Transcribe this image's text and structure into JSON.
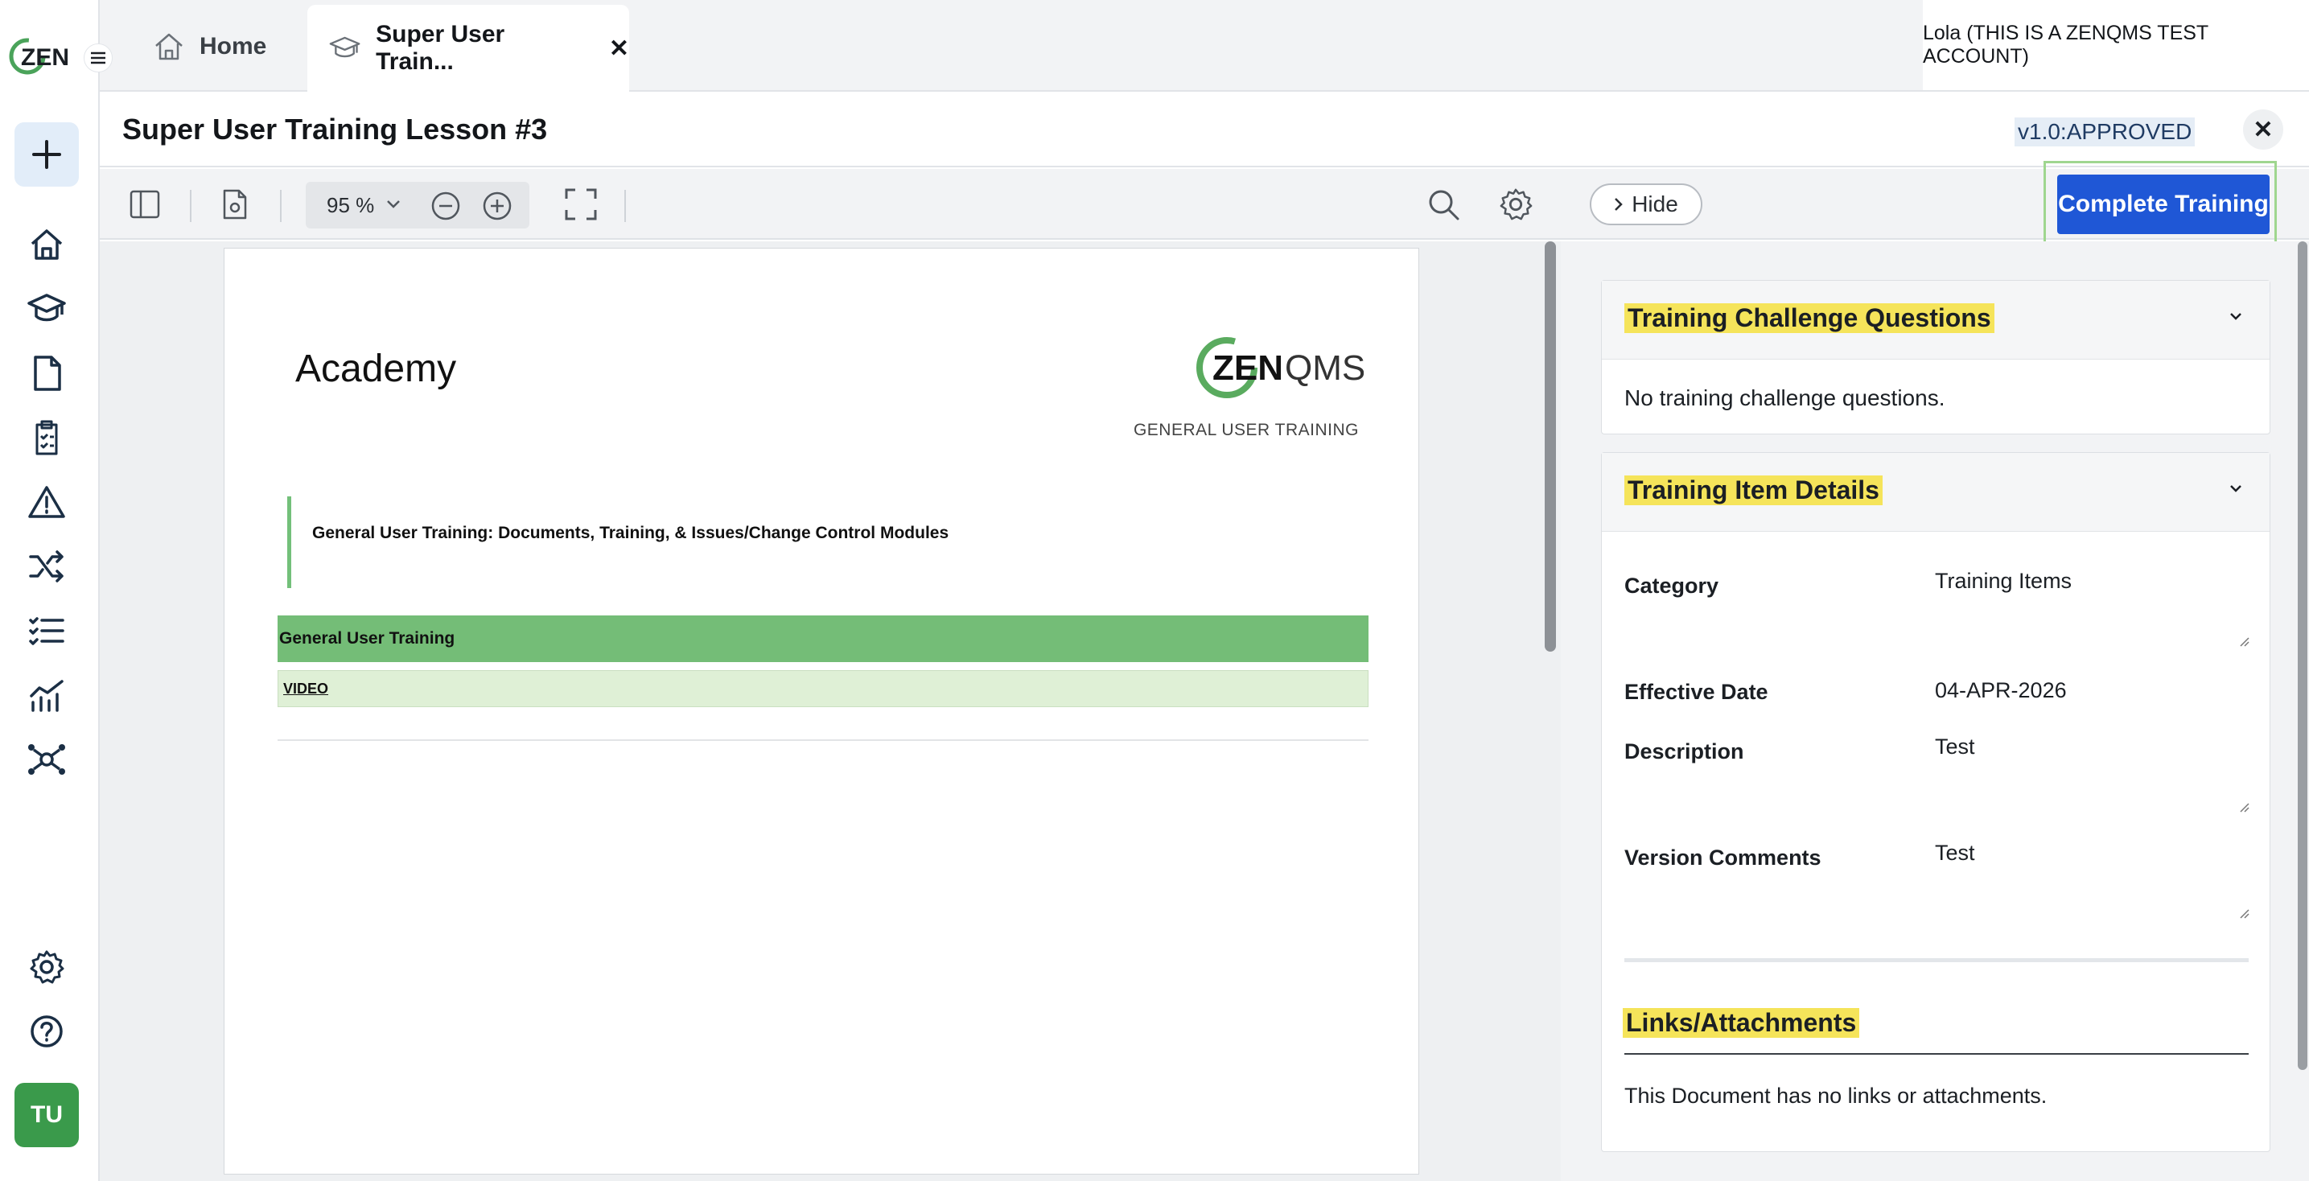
{
  "app": {
    "logo_text": "ZEN",
    "avatar_initials": "TU"
  },
  "tabs": {
    "home_label": "Home",
    "active_label": "Super User Train...",
    "close_symbol": "✕"
  },
  "user": {
    "name": "Lola (THIS IS A ZENQMS TEST ACCOUNT)"
  },
  "document": {
    "title": "Super User Training Lesson #3",
    "version_status": "v1.0:APPROVED",
    "close_symbol": "✕"
  },
  "toolbar": {
    "zoom_value": "95 %",
    "hide_label": "Hide",
    "complete_label": "Complete Training"
  },
  "pdf": {
    "heading": "Academy",
    "logo_text_bold": "ZEN",
    "logo_text_light": "QMS",
    "subtitle": "GENERAL USER TRAINING",
    "quote": "General User Training: Documents, Training, & Issues/Change Control Modules",
    "section_row": "General User Training",
    "link_row": "VIDEO"
  },
  "panel": {
    "challenge": {
      "title": "Training Challenge Questions",
      "empty_text": "No training challenge questions."
    },
    "details": {
      "title": "Training Item Details",
      "fields": [
        {
          "label": "Category",
          "value": "Training Items"
        },
        {
          "label": "Effective Date",
          "value": "04-APR-2026"
        },
        {
          "label": "Description",
          "value": "Test"
        },
        {
          "label": "Version Comments",
          "value": "Test"
        }
      ],
      "links_title": "Links/Attachments",
      "links_empty": "This Document has no links or attachments."
    }
  },
  "colors": {
    "primary_button": "#1f57d6",
    "highlight": "#f5e45a",
    "brand_green": "#3a9a4b",
    "table_green": "#74bd77"
  }
}
